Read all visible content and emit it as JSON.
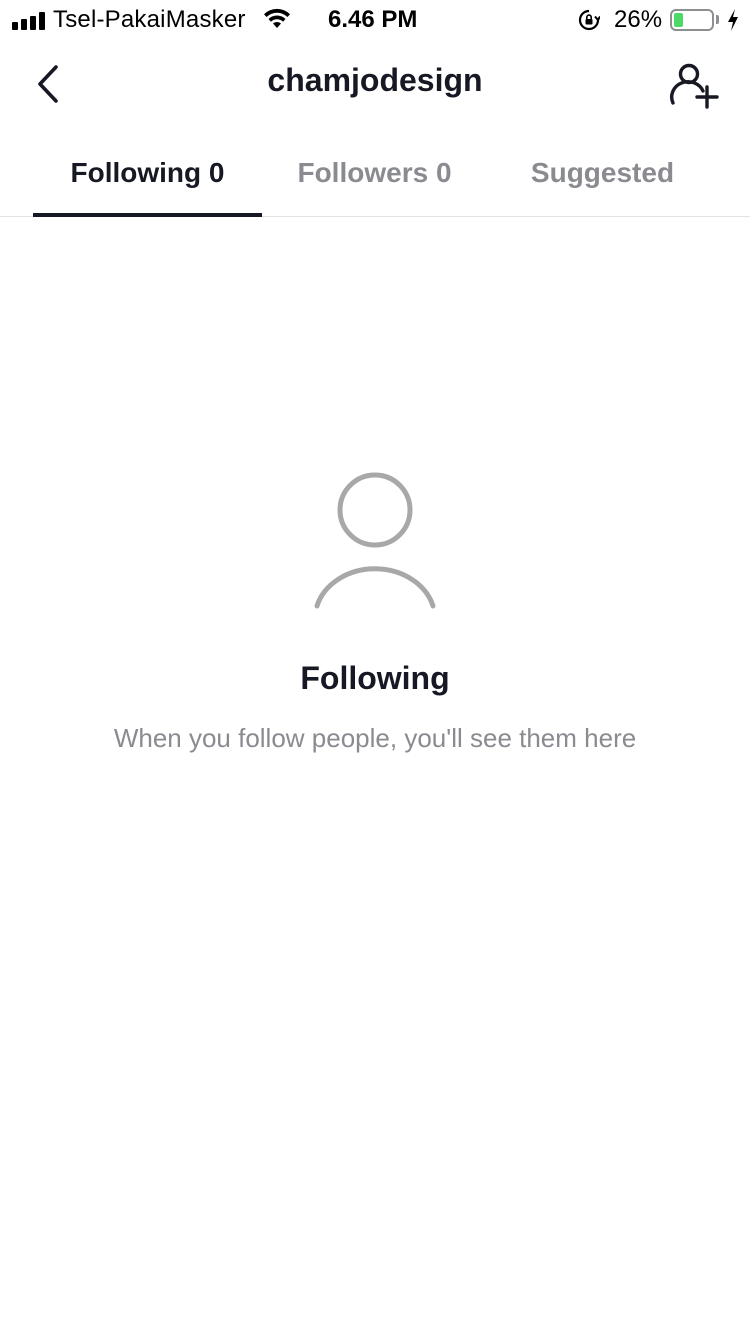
{
  "status_bar": {
    "carrier": "Tsel-PakaiMasker",
    "time": "6.46 PM",
    "battery_percent_label": "26%",
    "battery_level": 0.26,
    "battery_color": "#4cd964",
    "icons": [
      "signal-icon",
      "wifi-icon",
      "rotation-lock-icon",
      "battery-icon",
      "charging-bolt-icon"
    ]
  },
  "header": {
    "title": "chamjodesign",
    "back_icon": "chevron-left-icon",
    "add_user_icon": "add-user-icon"
  },
  "tabs": [
    {
      "label": "Following 0",
      "active": true
    },
    {
      "label": "Followers 0",
      "active": false
    },
    {
      "label": "Suggested",
      "active": false
    }
  ],
  "empty_state": {
    "icon": "person-outline-icon",
    "title": "Following",
    "message": "When you follow people, you'll see them here"
  },
  "colors": {
    "text_primary": "#161823",
    "text_secondary": "#8a8b91",
    "icon_muted": "#a8a8a8",
    "divider": "#e3e3e4"
  }
}
